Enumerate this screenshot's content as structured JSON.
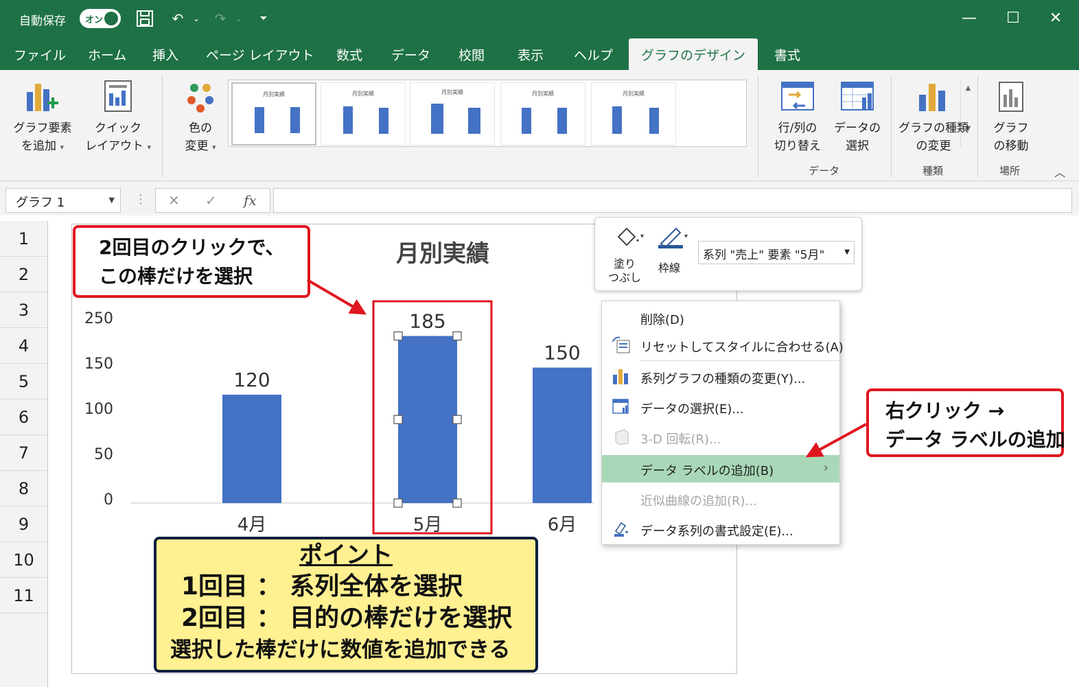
{
  "titlebar": {
    "autosave_label": "自動保存",
    "autosave_state": "オン",
    "window_buttons": [
      "minimize",
      "maximize",
      "close"
    ]
  },
  "ribbon_tabs": [
    "ファイル",
    "ホーム",
    "挿入",
    "ページ レイアウト",
    "数式",
    "データ",
    "校閲",
    "表示",
    "ヘルプ",
    "グラフのデザイン",
    "書式"
  ],
  "active_tab": "グラフのデザイン",
  "ribbon": {
    "add_element": [
      "グラフ要素",
      "を追加"
    ],
    "quick_layout": [
      "クイック",
      "レイアウト"
    ],
    "change_colors": [
      "色の",
      "変更"
    ],
    "gallery_thumb_title": "月別実績",
    "switch_row_col": [
      "行/列の",
      "切り替え"
    ],
    "select_data": [
      "データの",
      "選択"
    ],
    "change_type": [
      "グラフの種類",
      "の変更"
    ],
    "move_chart": [
      "グラフ",
      "の移動"
    ],
    "group_data": "データ",
    "group_type": "種類",
    "group_location": "場所"
  },
  "formula_bar": {
    "name_box": "グラフ 1",
    "fx": "fx",
    "value": ""
  },
  "rows": [
    "1",
    "2",
    "3",
    "4",
    "5",
    "6",
    "7",
    "8",
    "9",
    "10",
    "11"
  ],
  "chart_data": {
    "type": "bar",
    "title": "月別実績",
    "categories": [
      "4月",
      "5月",
      "6月"
    ],
    "series": [
      {
        "name": "売上",
        "values": [
          120,
          185,
          150
        ]
      }
    ],
    "data_labels": [
      "120",
      "185",
      "150"
    ],
    "y_ticks": [
      "250",
      "150",
      "100",
      "50",
      "0"
    ],
    "bar_color": "#4472c4",
    "selected_category": "5月"
  },
  "mini_toolbar": {
    "fill": [
      "塗り",
      "つぶし"
    ],
    "outline": "枠線",
    "element_selector": "系列 \"売上\" 要素 \"5月\""
  },
  "context_menu": [
    {
      "label": "削除(D)",
      "state": "enabled"
    },
    {
      "label": "リセットしてスタイルに合わせる(A)",
      "state": "enabled"
    },
    {
      "label": "系列グラフの種類の変更(Y)...",
      "state": "enabled"
    },
    {
      "label": "データの選択(E)...",
      "state": "enabled"
    },
    {
      "label": "3-D 回転(R)...",
      "state": "disabled"
    },
    {
      "label": "データ ラベルの追加(B)",
      "state": "highlighted"
    },
    {
      "label": "近似曲線の追加(R)...",
      "state": "disabled"
    },
    {
      "label": "データ系列の書式設定(E)...",
      "state": "enabled"
    }
  ],
  "callouts": {
    "click_line1": "2回目のクリックで、",
    "click_line2": "この棒だけを選択",
    "right_line1": "右クリック →",
    "right_line2": "データ ラベルの追加",
    "tip_title": "ポイント",
    "tip_line1": "1回目 ： 系列全体を選択",
    "tip_line2": "2回目 ： 目的の棒だけを選択",
    "tip_line3": "選択した棒だけに数値を追加できる"
  },
  "colors": {
    "excel_green": "#1e7145",
    "bar_blue": "#4472c4",
    "highlight_green": "#a9d8b8",
    "callout_red": "#e0161f",
    "tip_yellow": "#fff091"
  }
}
